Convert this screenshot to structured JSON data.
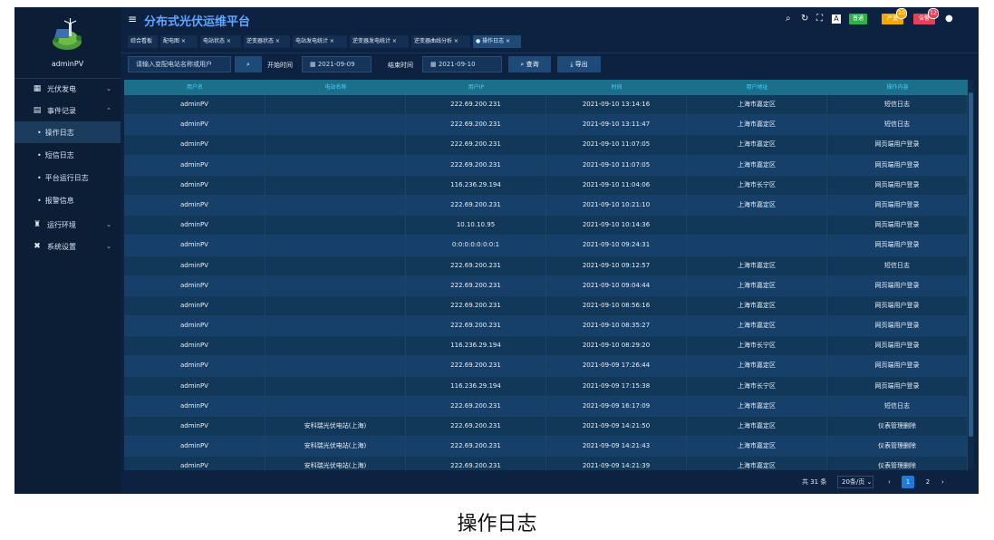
{
  "user": {
    "name": "adminPV"
  },
  "app": {
    "title": "分布式光伏运维平台",
    "menu_icon": "≡"
  },
  "toolbar": {
    "icons": [
      "search-icon",
      "refresh-icon",
      "fullscreen-icon",
      "language-icon"
    ],
    "badges": [
      {
        "label": "普通",
        "color": "#2bb34a",
        "count": ""
      },
      {
        "label": "严重",
        "color": "#f2a900",
        "count": "10"
      },
      {
        "label": "告警",
        "color": "#e9405a",
        "count": "12"
      }
    ]
  },
  "sidebar": {
    "items": [
      {
        "label": "光伏发电",
        "icon": "grid-icon",
        "chevron": "⌄"
      },
      {
        "label": "事件记录",
        "icon": "record-icon",
        "chevron": "⌃"
      },
      {
        "label": "运行环境",
        "icon": "env-icon",
        "chevron": "⌄"
      },
      {
        "label": "系统设置",
        "icon": "settings-icon",
        "chevron": "⌄"
      }
    ],
    "sub_items": [
      {
        "label": "操作日志",
        "active": true
      },
      {
        "label": "短信日志",
        "active": false
      },
      {
        "label": "平台运行日志",
        "active": false
      },
      {
        "label": "报警信息",
        "active": false
      }
    ]
  },
  "tabs": [
    {
      "label": "综合看板",
      "closable": false
    },
    {
      "label": "配电图 ×",
      "closable": true
    },
    {
      "label": "电站状态 ×",
      "closable": true
    },
    {
      "label": "逆变器状态 ×",
      "closable": true
    },
    {
      "label": "电站发电统计 ×",
      "closable": true
    },
    {
      "label": "逆变器发电统计 ×",
      "closable": true
    },
    {
      "label": "逆变器曲线分析 ×",
      "closable": true
    },
    {
      "label": "● 操作日志 ×",
      "closable": true
    }
  ],
  "filter": {
    "search_placeholder": "请输入变配电站名称或用户",
    "start_label": "开始时间",
    "start_value": "2021-09-09",
    "end_label": "结束时间",
    "end_value": "2021-09-10",
    "query_label": "查询",
    "export_label": "导出"
  },
  "table": {
    "headers": [
      "用户名",
      "电站名称",
      "用户IP",
      "时间",
      "用户地址",
      "操作内容"
    ],
    "rows": [
      [
        "adminPV",
        "",
        "222.69.200.231",
        "2021-09-10 13:14:16",
        "上海市嘉定区",
        "短信日志"
      ],
      [
        "adminPV",
        "",
        "222.69.200.231",
        "2021-09-10 13:11:47",
        "上海市嘉定区",
        "短信日志"
      ],
      [
        "adminPV",
        "",
        "222.69.200.231",
        "2021-09-10 11:07:05",
        "上海市嘉定区",
        "网页端用户登录"
      ],
      [
        "adminPV",
        "",
        "222.69.200.231",
        "2021-09-10 11:07:05",
        "上海市嘉定区",
        "网页端用户登录"
      ],
      [
        "adminPV",
        "",
        "116.236.29.194",
        "2021-09-10 11:04:06",
        "上海市长宁区",
        "网页端用户登录"
      ],
      [
        "adminPV",
        "",
        "222.69.200.231",
        "2021-09-10 10:21:10",
        "上海市嘉定区",
        "网页端用户登录"
      ],
      [
        "adminPV",
        "",
        "10.10.10.95",
        "2021-09-10 10:14:36",
        "",
        "网页端用户登录"
      ],
      [
        "adminPV",
        "",
        "0:0:0:0:0:0:0:1",
        "2021-09-10 09:24:31",
        "",
        "网页端用户登录"
      ],
      [
        "adminPV",
        "",
        "222.69.200.231",
        "2021-09-10 09:12:57",
        "上海市嘉定区",
        "短信日志"
      ],
      [
        "adminPV",
        "",
        "222.69.200.231",
        "2021-09-10 09:04:44",
        "上海市嘉定区",
        "网页端用户登录"
      ],
      [
        "adminPV",
        "",
        "222.69.200.231",
        "2021-09-10 08:56:16",
        "上海市嘉定区",
        "网页端用户登录"
      ],
      [
        "adminPV",
        "",
        "222.69.200.231",
        "2021-09-10 08:35:27",
        "上海市嘉定区",
        "网页端用户登录"
      ],
      [
        "adminPV",
        "",
        "116.236.29.194",
        "2021-09-10 08:29:20",
        "上海市长宁区",
        "网页端用户登录"
      ],
      [
        "adminPV",
        "",
        "222.69.200.231",
        "2021-09-09 17:26:44",
        "上海市嘉定区",
        "网页端用户登录"
      ],
      [
        "adminPV",
        "",
        "116.236.29.194",
        "2021-09-09 17:15:38",
        "上海市长宁区",
        "网页端用户登录"
      ],
      [
        "adminPV",
        "",
        "222.69.200.231",
        "2021-09-09 16:17:09",
        "上海市嘉定区",
        "短信日志"
      ],
      [
        "adminPV",
        "安科瑞光伏电站(上海)",
        "222.69.200.231",
        "2021-09-09 14:21:50",
        "上海市嘉定区",
        "仪表管理删除"
      ],
      [
        "adminPV",
        "安科瑞光伏电站(上海)",
        "222.69.200.231",
        "2021-09-09 14:21:43",
        "上海市嘉定区",
        "仪表管理删除"
      ],
      [
        "adminPV",
        "安科瑞光伏电站(上海)",
        "222.69.200.231",
        "2021-09-09 14:21:39",
        "上海市嘉定区",
        "仪表管理删除"
      ]
    ]
  },
  "pager": {
    "total": "共 31 条",
    "page_size": "20条/页 ⌄",
    "prev": "‹",
    "pages": [
      "1",
      "2"
    ],
    "current": "1",
    "next": "›"
  },
  "caption": "操作日志",
  "colors": {
    "accent": "#5ea6ff",
    "header_text": "#3fd6ff",
    "bg": "#0d2240"
  }
}
